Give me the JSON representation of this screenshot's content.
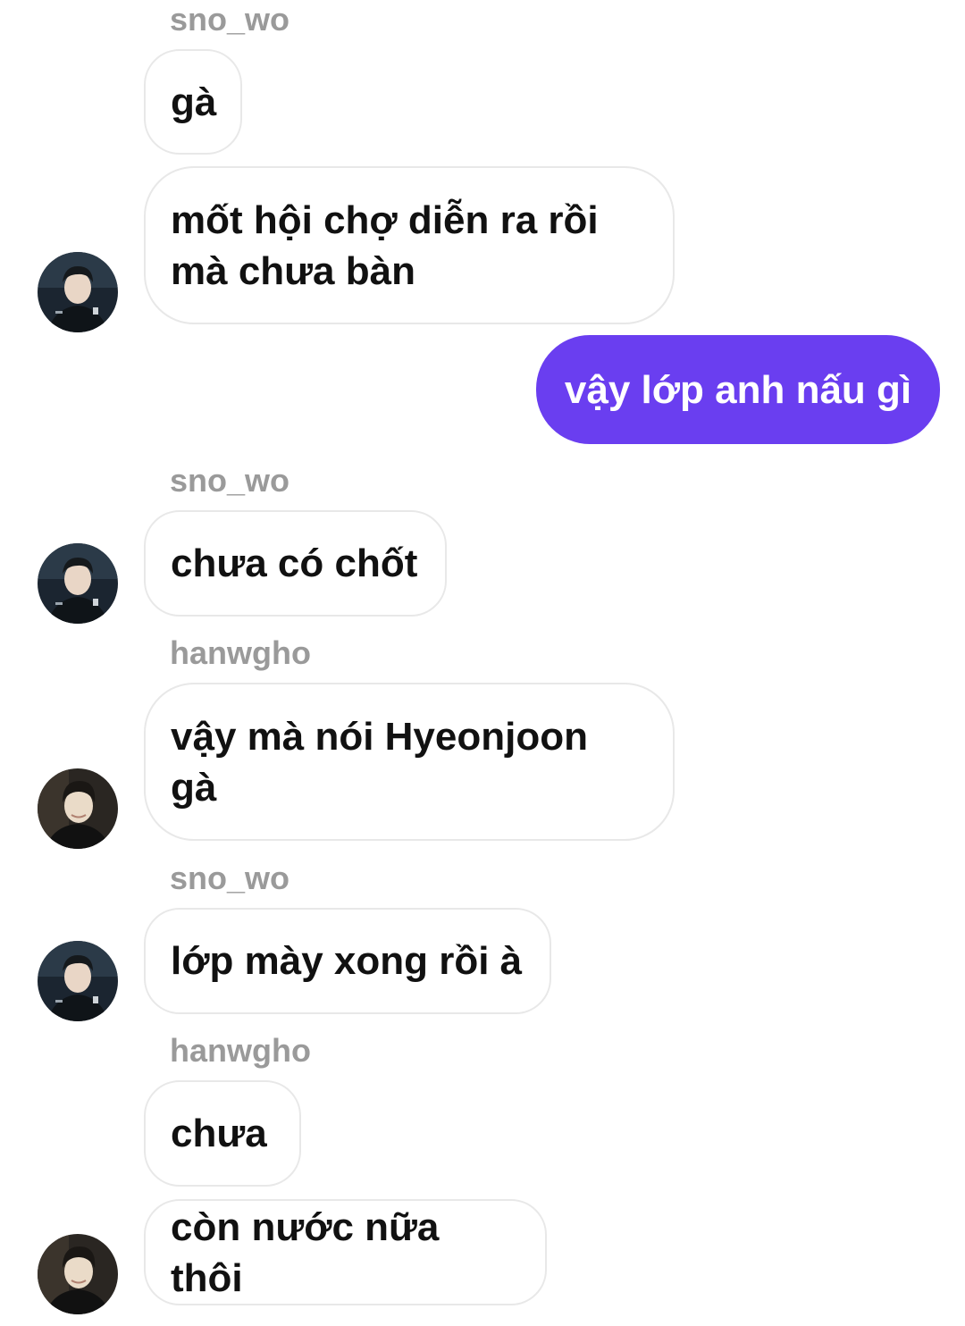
{
  "messages": [
    {
      "sender": "sno_wo",
      "text": "gà"
    },
    {
      "text": "mốt hội chợ diễn ra rồi\nmà chưa bàn"
    },
    {
      "text": "vậy lớp anh nấu gì"
    },
    {
      "sender": "sno_wo",
      "text": "chưa có chốt"
    },
    {
      "sender": "hanwgho",
      "text": "vậy mà nói Hyeonjoon\ngà"
    },
    {
      "sender": "sno_wo",
      "text": "lớp mày xong rồi à"
    },
    {
      "sender": "hanwgho",
      "text": "chưa"
    },
    {
      "text": "còn nước nữa thôi"
    }
  ],
  "colors": {
    "outgoing_bubble": "#6a3ef0",
    "incoming_bubble_border": "#e8e8e8",
    "sender_name": "#9a9a9a"
  }
}
